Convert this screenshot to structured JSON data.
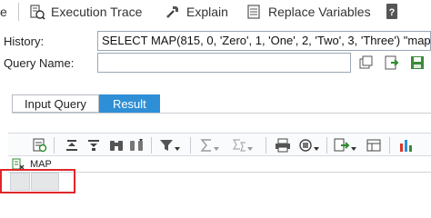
{
  "toolbar": {
    "partial_label": "e",
    "execution_trace_label": "Execution Trace",
    "explain_label": "Explain",
    "replace_variables_label": "Replace Variables"
  },
  "form": {
    "history_label": "History:",
    "history_value": "SELECT MAP(815, 0, 'Zero', 1, 'One', 2, 'Two', 3, 'Three') \"map\"",
    "query_name_label": "Query Name:",
    "query_name_value": ""
  },
  "tabs": [
    {
      "label": "Input Query",
      "active": false
    },
    {
      "label": "Result",
      "active": true
    }
  ],
  "grid": {
    "columns": [
      "MAP"
    ],
    "rows": [
      [
        ""
      ]
    ]
  },
  "colors": {
    "accent": "#2f8fd6",
    "highlight": "#e0262a"
  }
}
